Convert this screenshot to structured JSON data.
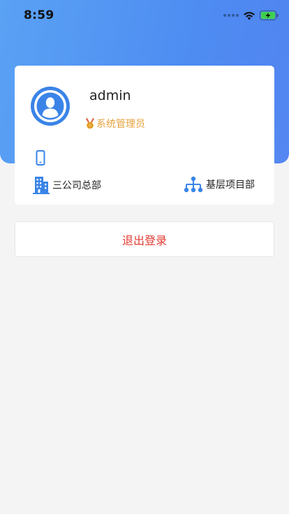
{
  "status_bar": {
    "time": "8:59",
    "icons": [
      "signal-dots-icon",
      "wifi-icon",
      "battery-charging-icon"
    ]
  },
  "profile": {
    "username": "admin",
    "role": "系统管理员",
    "role_icon": "medal-icon",
    "avatar_icon": "user-avatar-icon",
    "phone_icon": "mobile-phone-icon",
    "phone": "",
    "company": "三公司总部",
    "company_icon": "building-icon",
    "department": "基层项目部",
    "department_icon": "org-tree-icon"
  },
  "actions": {
    "logout_label": "退出登录"
  },
  "colors": {
    "header_gradient_start": "#5aa2f4",
    "header_gradient_end": "#4a7ff0",
    "avatar_bg": "#3a84e8",
    "role_text": "#e8a13a",
    "logout_text": "#e23a32",
    "page_bg": "#f4f4f4"
  }
}
